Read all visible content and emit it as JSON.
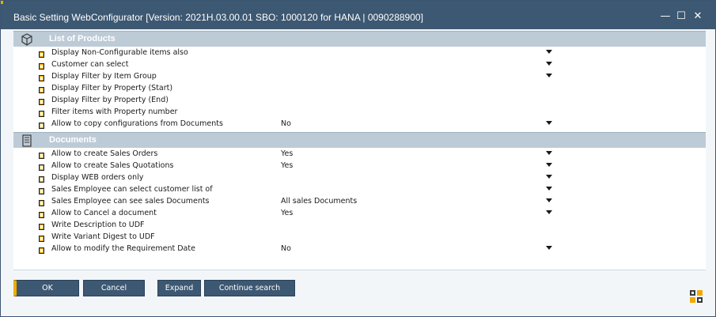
{
  "window": {
    "title": "Basic Setting WebConfigurator [Version: 2021H.03.00.01 SBO: 1000120 for HANA | 0090288900]",
    "controls": {
      "minimize": "—",
      "maximize": "☐",
      "close": "✕"
    }
  },
  "sections": [
    {
      "title": "List of Products",
      "icon": "cube-icon",
      "rows": [
        {
          "label": "Display Non-Configurable items also",
          "value": "",
          "has_dropdown": true
        },
        {
          "label": "Customer can select",
          "value": "",
          "has_dropdown": true
        },
        {
          "label": "Display Filter by Item Group",
          "value": "",
          "has_dropdown": true
        },
        {
          "label": "Display Filter by Property (Start)",
          "value": "",
          "has_dropdown": false
        },
        {
          "label": "Display Filter by Property (End)",
          "value": "",
          "has_dropdown": false
        },
        {
          "label": "Filter items with Property number",
          "value": "",
          "has_dropdown": false
        },
        {
          "label": "Allow to copy configurations from Documents",
          "value": "No",
          "has_dropdown": true
        }
      ]
    },
    {
      "title": "Documents",
      "icon": "document-list-icon",
      "rows": [
        {
          "label": "Allow to create Sales Orders",
          "value": "Yes",
          "has_dropdown": true
        },
        {
          "label": "Allow to create Sales Quotations",
          "value": "Yes",
          "has_dropdown": true
        },
        {
          "label": "Display WEB orders only",
          "value": "",
          "has_dropdown": true
        },
        {
          "label": "Sales Employee can select customer list of",
          "value": "",
          "has_dropdown": true
        },
        {
          "label": "Sales Employee can see sales Documents",
          "value": "All sales Documents",
          "has_dropdown": true
        },
        {
          "label": "Allow to Cancel a document",
          "value": "Yes",
          "has_dropdown": true
        },
        {
          "label": "Write Description to UDF",
          "value": "",
          "has_dropdown": false
        },
        {
          "label": "Write Variant Digest to UDF",
          "value": "",
          "has_dropdown": false
        },
        {
          "label": "Allow to modify the Requirement Date",
          "value": "No",
          "has_dropdown": true
        }
      ]
    }
  ],
  "buttons": {
    "ok": "OK",
    "cancel": "Cancel",
    "expand": "Expand",
    "continue_search": "Continue search"
  },
  "colors": {
    "titlebar": "#3d5872",
    "section_header": "#bdcbd7",
    "accent": "#f0ab00"
  }
}
